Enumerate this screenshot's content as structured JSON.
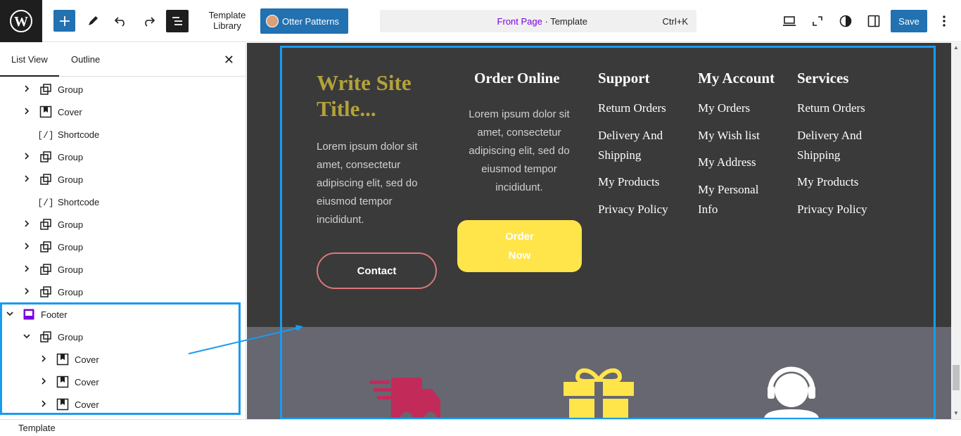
{
  "topbar": {
    "template_library": "Template Library",
    "otter_patterns": "Otter Patterns",
    "command": {
      "page": "Front Page",
      "sep": " · ",
      "type": "Template",
      "shortcut": "Ctrl+K"
    },
    "save": "Save"
  },
  "sidebar": {
    "tabs": [
      "List View",
      "Outline"
    ],
    "rows": [
      {
        "label": "Group",
        "chev": "›",
        "icon": "group-icon"
      },
      {
        "label": "Cover",
        "chev": "›",
        "icon": "cover-icon"
      },
      {
        "label": "Shortcode",
        "chev": "",
        "icon": "shortcode-icon"
      },
      {
        "label": "Group",
        "chev": "›",
        "icon": "group-icon"
      },
      {
        "label": "Group",
        "chev": "›",
        "icon": "group-icon"
      },
      {
        "label": "Shortcode",
        "chev": "",
        "icon": "shortcode-icon"
      },
      {
        "label": "Group",
        "chev": "›",
        "icon": "group-icon"
      },
      {
        "label": "Group",
        "chev": "›",
        "icon": "group-icon"
      },
      {
        "label": "Group",
        "chev": "›",
        "icon": "group-icon"
      },
      {
        "label": "Group",
        "chev": "›",
        "icon": "group-icon"
      },
      {
        "label": "Footer",
        "chev": "⌄",
        "icon": "footer-icon"
      },
      {
        "label": "Group",
        "chev": "⌄",
        "icon": "group-icon"
      },
      {
        "label": "Cover",
        "chev": "›",
        "icon": "cover-icon"
      },
      {
        "label": "Cover",
        "chev": "›",
        "icon": "cover-icon"
      },
      {
        "label": "Cover",
        "chev": "›",
        "icon": "cover-icon"
      }
    ]
  },
  "status": "Template",
  "footer": {
    "site_title": "Write Site Title...",
    "about": "Lorem ipsum dolor sit amet, consectetur adipiscing elit, sed do eiusmod tempor incididunt.",
    "contact_button": "Contact",
    "order_online": {
      "heading": "Order Online",
      "text": "Lorem ipsum dolor sit amet, consectetur adipiscing elit, sed do eiusmod tempor incididunt.",
      "button": "Order Now"
    },
    "support": {
      "heading": "Support",
      "links": [
        "Return Orders",
        "Delivery And Shipping",
        "My Products",
        "Privacy Policy"
      ]
    },
    "account": {
      "heading": "My Account",
      "links": [
        "My Orders",
        "My Wish list",
        "My Address",
        "My Personal Info"
      ]
    },
    "services": {
      "heading": "Services",
      "links": [
        "Return Orders",
        "Delivery And Shipping",
        "My Products",
        "Privacy Policy"
      ]
    }
  },
  "colors": {
    "accent": "#2271b1",
    "highlight": "#1a9bf0",
    "title": "#b3a23a",
    "order_button": "#ffe44a",
    "truck": "#c22a5a"
  }
}
